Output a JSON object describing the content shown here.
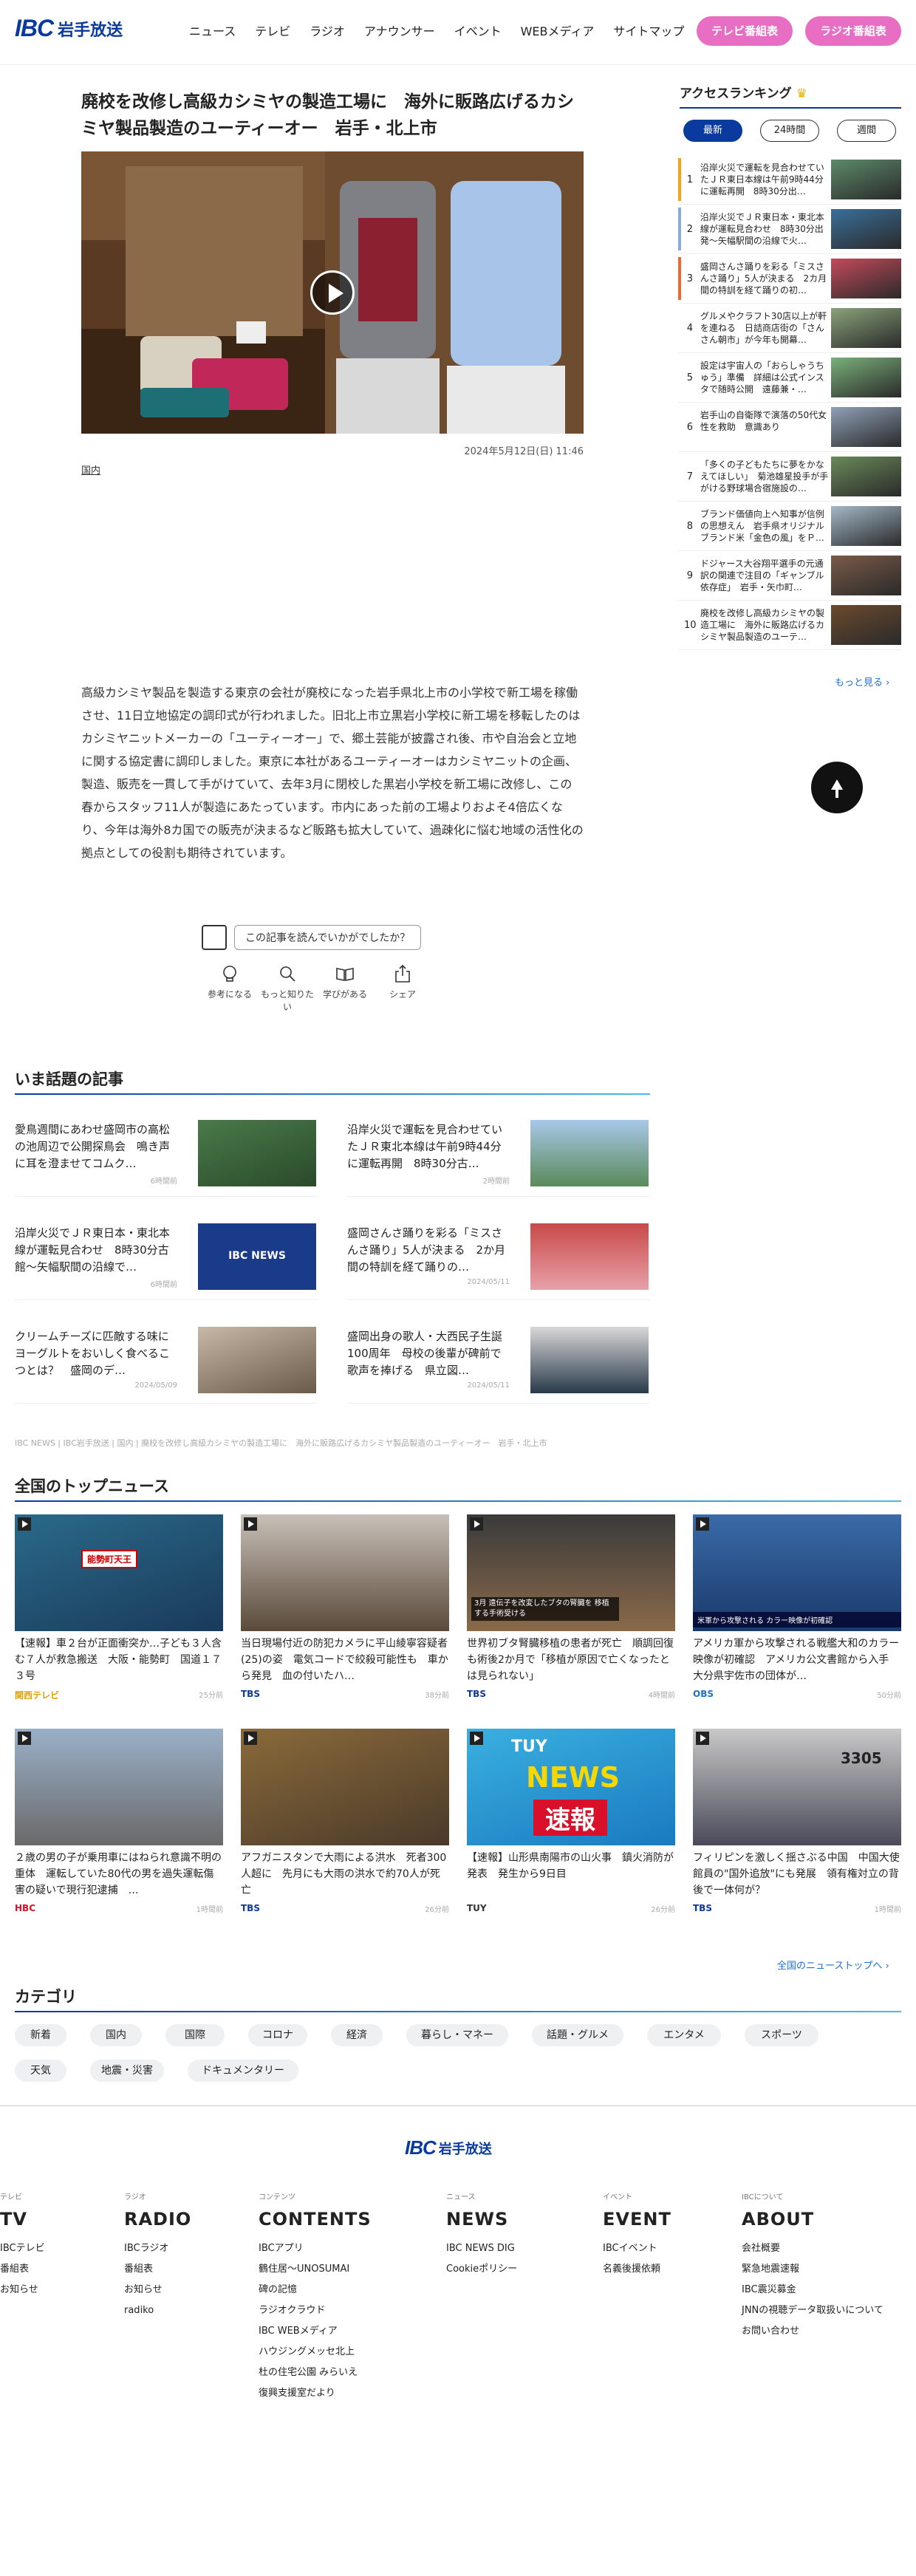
{
  "header": {
    "logo": "IBC",
    "logo_sub": "岩手放送",
    "nav": [
      "ニュース",
      "テレビ",
      "ラジオ",
      "アナウンサー",
      "イベント",
      "WEBメディア",
      "サイトマップ"
    ],
    "tv_button": "テレビ番組表",
    "radio_button": "ラジオ番組表"
  },
  "article": {
    "title": "廃校を改修し高級カシミヤの製造工場に　海外に販路広げるカシミヤ製品製造のユーティーオー　岩手・北上市",
    "date": "2024年5月12日(日) 11:46",
    "tag": "国内",
    "body": "高級カシミヤ製品を製造する東京の会社が廃校になった岩手県北上市の小学校で新工場を稼働させ、11日立地協定の調印式が行われました。旧北上市立黒岩小学校に新工場を移転したのはカシミヤニットメーカーの「ユーティーオー」で、郷土芸能が披露され後、市や自治会と立地に関する協定書に調印しました。東京に本社があるユーティーオーはカシミヤニットの企画、製造、販売を一貫して手がけていて、去年3月に閉校した黒岩小学校を新工場に改修し、この春からスタッフ11人が製造にあたっています。市内にあった前の工場よりおよそ4倍広くなり、今年は海外8カ国での販売が決まるなど販路も拡大していて、過疎化に悩む地域の活性化の拠点としての役割も期待されています。",
    "rate_prompt": "この記事を読んでいかがでしたか？",
    "reactions": [
      "参考になる",
      "もっと知りたい",
      "学びがある",
      "シェア"
    ]
  },
  "ranking": {
    "title": "アクセスランキング",
    "tabs": [
      "最新",
      "24時間",
      "週間"
    ],
    "items": [
      {
        "num": "1",
        "text": "沿岸火災で運転を見合わせていたＪＲ東日本線は午前9時44分に運転再開　8時30分出…",
        "color": "#f2a120"
      },
      {
        "num": "2",
        "text": "沿岸火災でＪＲ東日本・東北本線が運転見合わせ　8時30分出発～矢幅駅間の沿線で火…",
        "color": "#8fa9d9"
      },
      {
        "num": "3",
        "text": "盛岡さんさ踊りを彩る「ミスさんさ踊り」5人が決まる　2カ月間の特訓を経て踊りの初…",
        "color": "#e46b3c"
      },
      {
        "num": "4",
        "text": "グルメやクラフト30店以上が軒を連ねる　日詰商店街の「さんさん朝市」が今年も開幕…",
        "color": ""
      },
      {
        "num": "5",
        "text": "設定は宇宙人の「おらしゃうちゅう」準備　詳細は公式インスタで随時公開　遠藤兼・…",
        "color": ""
      },
      {
        "num": "6",
        "text": "岩手山の自衛隊で演落の50代女性を救助　意識あり",
        "color": ""
      },
      {
        "num": "7",
        "text": "「多くの子どもたちに夢をかなえてほしい」　菊池雄星投手が手がける野球場合宿施設の…",
        "color": ""
      },
      {
        "num": "8",
        "text": "ブランド価値向上へ知事が信例の思想えん　岩手県オリジナルブランド米「金色の風」をＰ…",
        "color": ""
      },
      {
        "num": "9",
        "text": "ドジャース大谷翔平選手の元通訳の関連で注目の「ギャンブル依存症」　岩手・矢巾町…",
        "color": ""
      },
      {
        "num": "10",
        "text": "廃校を改修し高級カシミヤの製造工場に　海外に販路広げるカシミヤ製品製造のユーテ…",
        "color": ""
      }
    ],
    "more": "もっと見る ›"
  },
  "talk": {
    "title": "いま話題の記事",
    "items": [
      {
        "title": "愛鳥週間にあわせ盛岡市の高松の池周辺で公開探鳥会　鳴き声に耳を澄ませてコムク…",
        "time": "6時間前"
      },
      {
        "title": "沿岸火災で運転を見合わせていたＪＲ東北本線は午前9時44分に運転再開　8時30分古…",
        "time": "2時間前"
      },
      {
        "title": "沿岸火災でＪＲ東日本・東北本線が運転見合わせ　8時30分古館～矢幅駅間の沿線で…",
        "time": "6時間前"
      },
      {
        "title": "盛岡さんさ踊りを彩る「ミスさんさ踊り」5人が決まる　2か月間の特訓を経て踊りの…",
        "time": "2024/05/11"
      },
      {
        "title": "クリームチーズに匹敵する味に　ヨーグルトをおいしく食べるこつとは？　盛岡のデ…",
        "time": "2024/05/09"
      },
      {
        "title": "盛岡出身の歌人・大西民子生誕100周年　母校の後輩が碑前で歌声を捧げる　県立図…",
        "time": "2024/05/11"
      }
    ]
  },
  "breadcrumb": "IBC NEWS | IBC岩手放送 | 国内 | 廃校を改修し高級カシミヤの製造工場に　海外に販路広げるカシミヤ製品製造のユーティーオー　岩手・北上市",
  "top_news": {
    "title": "全国のトップニュース",
    "items": [
      {
        "title": "【速報】車２台が正面衝突か…子ども３人含む７人が救急搬送　大阪・能勢町　国道１７３号",
        "src": "関西テレビ",
        "src_color": "#e2a100",
        "time": "25分前"
      },
      {
        "title": "当日現場付近の防犯カメラに平山綾寧容疑者(25)の姿　電気コードで絞殺可能性も　車から発見　血の付いたハ…",
        "src": "TBS",
        "src_color": "#0a3a9e",
        "time": "38分前"
      },
      {
        "title": "世界初ブタ腎臓移植の患者が死亡　順調回復も術後2か月で「移植が原因で亡くなったとは見られない」",
        "src": "TBS",
        "src_color": "#0a3a9e",
        "time": "4時間前"
      },
      {
        "title": "アメリカ軍から攻撃される戦艦大和のカラー映像が初確認　アメリカ公文書館から入手　大分県宇佐市の団体が…",
        "src": "OBS",
        "src_color": "#1d6fd1",
        "time": "50分前"
      },
      {
        "title": "２歳の男の子が乗用車にはねられ意識不明の重体　運転していた80代の男を過失運転傷害の疑いで現行犯逮捕　…",
        "src": "HBC",
        "src_color": "#d8102a",
        "time": "1時間前"
      },
      {
        "title": "アフガニスタンで大雨による洪水　死者300人超に　先月にも大雨の洪水で約70人が死亡",
        "src": "TBS",
        "src_color": "#0a3a9e",
        "time": "26分前"
      },
      {
        "title": "【速報】山形県南陽市の山火事　鎮火消防が発表　発生から9日目",
        "src": "TUY",
        "src_color": "#333",
        "time": "26分前"
      },
      {
        "title": "フィリピンを激しく揺さぶる中国　中国大使館員の\"国外追放\"にも発展　領有権対立の背後で一体何が？",
        "src": "TBS",
        "src_color": "#0a3a9e",
        "time": "1時間前"
      }
    ],
    "all_link": "全国のニューストップへ ›"
  },
  "thumb_text": {
    "ibc_news": "IBC NEWS",
    "map_label": "能勢町天王",
    "news_label": "NEWS",
    "sokuho": "速報",
    "tuy_label": "TUY",
    "ship_number": "3305",
    "nhk_caption": "3月 遠伝子を改変したブタの腎臓を 移植する手術受ける",
    "ship_caption": "米軍から攻撃される カラー映像が初確認"
  },
  "category": {
    "title": "カテゴリ",
    "items": [
      "新着",
      "国内",
      "国際",
      "コロナ",
      "経済",
      "暮らし・マネー",
      "話題・グルメ",
      "エンタメ",
      "スポーツ",
      "天気",
      "地震・災害",
      "ドキュメンタリー"
    ]
  },
  "footer": {
    "columns": [
      {
        "small": "テレビ",
        "title": "TV",
        "links": [
          "IBCテレビ",
          "番組表",
          "お知らせ"
        ]
      },
      {
        "small": "ラジオ",
        "title": "RADIO",
        "links": [
          "IBCラジオ",
          "番組表",
          "お知らせ",
          "radiko"
        ]
      },
      {
        "small": "コンテンツ",
        "title": "CONTENTS",
        "links": [
          "IBCアプリ",
          "鶴住居～UNOSUMAI",
          "碑の記憶",
          "ラジオクラウド",
          "IBC WEBメディア",
          "ハウジングメッセ北上",
          "杜の住宅公園 みらいえ",
          "復興支援室だより"
        ]
      },
      {
        "small": "ニュース",
        "title": "NEWS",
        "links": [
          "IBC NEWS DIG",
          "Cookieポリシー"
        ]
      },
      {
        "small": "イベント",
        "title": "EVENT",
        "links": [
          "IBCイベント",
          "名義後援依頼"
        ]
      },
      {
        "small": "IBCについて",
        "title": "ABOUT",
        "links": [
          "会社概要",
          "緊急地震速報",
          "IBC震災募金",
          "JNNの視聴データ取扱いについて",
          "お問い合わせ"
        ]
      }
    ]
  }
}
